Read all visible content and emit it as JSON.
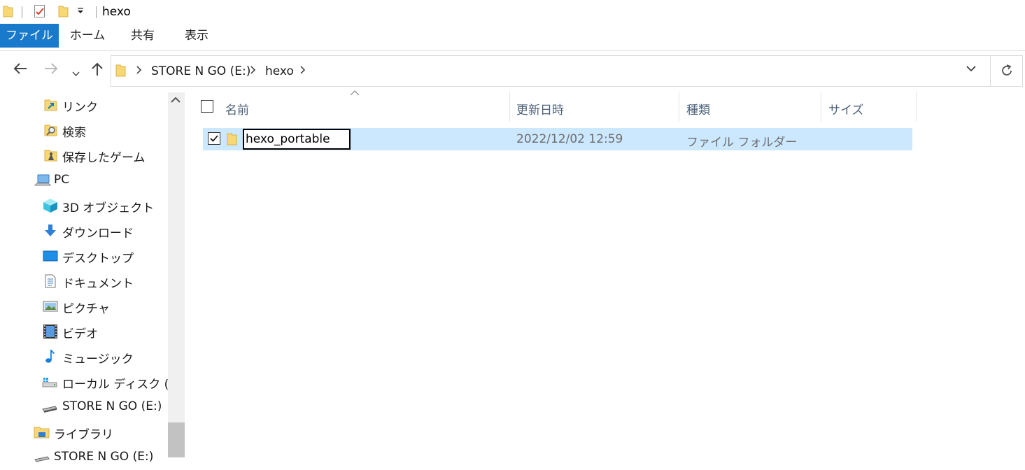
{
  "title": "hexo",
  "ribbon": {
    "tabs": [
      {
        "label": "ファイル"
      },
      {
        "label": "ホーム"
      },
      {
        "label": "共有"
      },
      {
        "label": "表示"
      }
    ]
  },
  "address": {
    "crumbs": [
      "STORE N GO (E:)",
      "hexo"
    ]
  },
  "nav": {
    "items": [
      {
        "label": "リンク",
        "icon": "links-folder-icon"
      },
      {
        "label": "検索",
        "icon": "search-folder-icon"
      },
      {
        "label": "保存したゲーム",
        "icon": "saved-games-folder-icon"
      },
      {
        "label": "PC",
        "icon": "pc-icon"
      },
      {
        "label": "3D オブジェクト",
        "icon": "3d-objects-icon"
      },
      {
        "label": "ダウンロード",
        "icon": "download-icon"
      },
      {
        "label": "デスクトップ",
        "icon": "desktop-icon"
      },
      {
        "label": "ドキュメント",
        "icon": "documents-icon"
      },
      {
        "label": "ピクチャ",
        "icon": "pictures-icon"
      },
      {
        "label": "ビデオ",
        "icon": "videos-icon"
      },
      {
        "label": "ミュージック",
        "icon": "music-icon"
      },
      {
        "label": "ローカル ディスク (C:)",
        "icon": "local-disk-icon"
      },
      {
        "label": "STORE N GO (E:)",
        "icon": "usb-drive-icon"
      },
      {
        "label": "ライブラリ",
        "icon": "libraries-icon"
      },
      {
        "label": "STORE N GO (E:)",
        "icon": "usb-drive-icon"
      }
    ]
  },
  "columns": {
    "name": "名前",
    "modified": "更新日時",
    "type": "種類",
    "size": "サイズ"
  },
  "files": [
    {
      "name": "hexo_portable",
      "modified": "2022/12/02 12:59",
      "type": "ファイル フォルダー",
      "size": "",
      "checked": true
    }
  ],
  "colors": {
    "file_tab": "#1979ca",
    "selection": "#cce8ff",
    "header_text": "#4c607a",
    "folder_yellow": "#f8d775"
  }
}
